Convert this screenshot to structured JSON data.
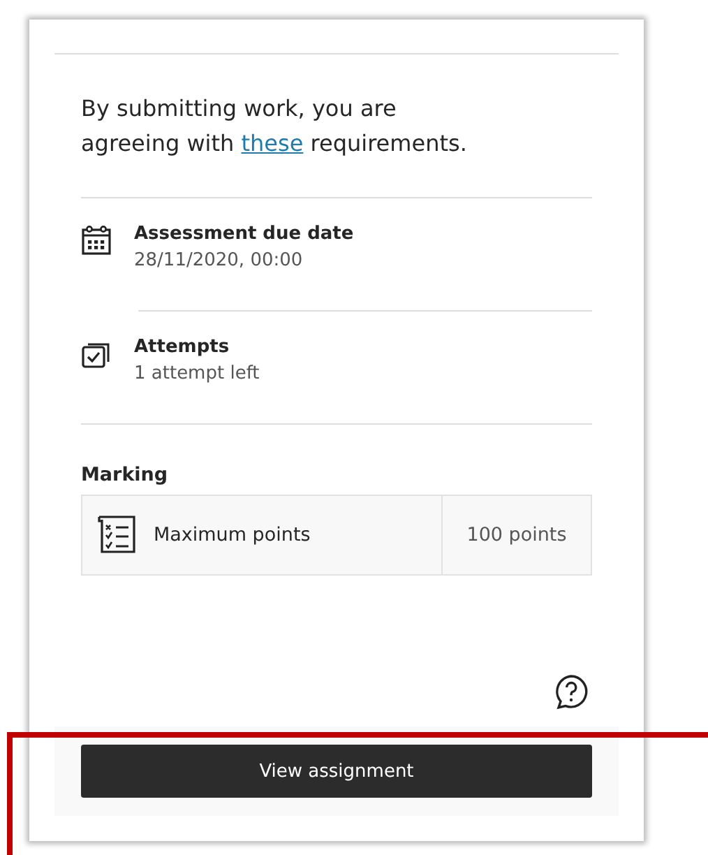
{
  "notice": {
    "text": "By submitting work, you are agreeing with ",
    "link": "these",
    "text_after": " requirements."
  },
  "details": [
    {
      "kind": "date",
      "label": "Assessment due date",
      "value": "28/11/2020, 00:00"
    },
    {
      "kind": "attempts",
      "label": "Attempts",
      "value": "1 attempt left"
    }
  ],
  "marking": {
    "heading": "Marking",
    "label": "Maximum points",
    "value": "100 points"
  },
  "button": "View assignment"
}
